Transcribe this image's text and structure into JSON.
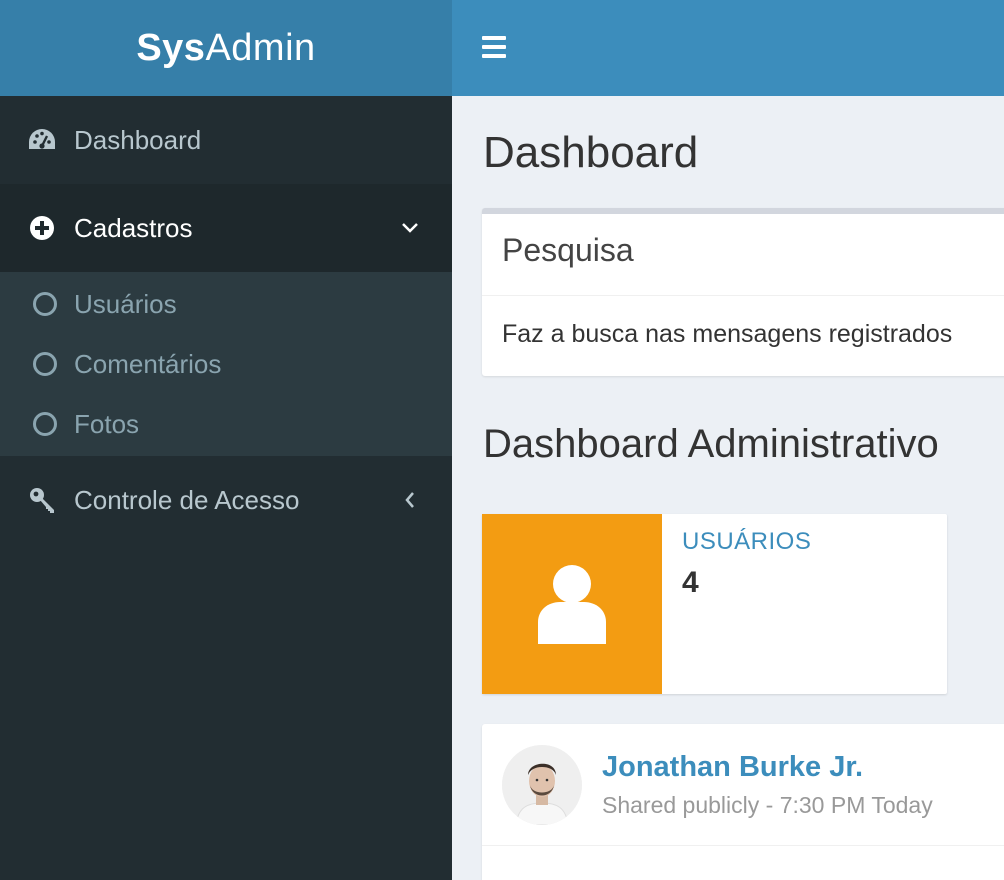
{
  "logo": {
    "bold": "Sys",
    "light": "Admin"
  },
  "topbar": {
    "menu_toggle_icon": "hamburger-icon"
  },
  "sidebar": {
    "items": [
      {
        "label": "Dashboard",
        "icon": "dashboard-icon"
      },
      {
        "label": "Cadastros",
        "icon": "plus-circle-icon",
        "expanded": true,
        "children": [
          {
            "label": "Usuários"
          },
          {
            "label": "Comentários"
          },
          {
            "label": "Fotos"
          }
        ]
      },
      {
        "label": "Controle de Acesso",
        "icon": "key-icon",
        "expanded": false
      }
    ]
  },
  "content": {
    "title": "Dashboard",
    "search_box": {
      "title": "Pesquisa",
      "body": "Faz a busca nas mensagens registrados"
    },
    "section_title": "Dashboard Administrativo",
    "info_box": {
      "label": "USUÁRIOS",
      "value": "4",
      "icon": "user-icon",
      "color": "#f39c12"
    },
    "post": {
      "user_name": "Jonathan Burke Jr.",
      "description": "Shared publicly - 7:30 PM Today"
    }
  },
  "colors": {
    "accent": "#3c8dbc",
    "logo_bg": "#367fa9",
    "sidebar_bg": "#222d32",
    "warning": "#f39c12"
  }
}
